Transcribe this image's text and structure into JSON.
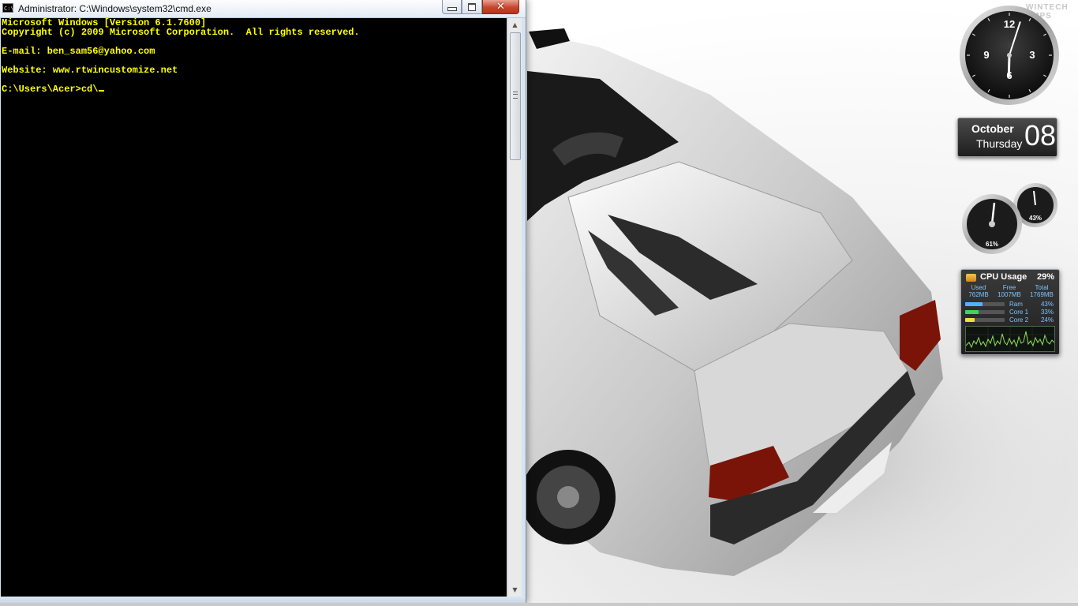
{
  "cmd_window": {
    "title": "Administrator: C:\\Windows\\system32\\cmd.exe",
    "icon": "cmd-icon",
    "icon_text": "C:\\",
    "controls": {
      "minimize": "minimize-icon",
      "maximize": "maximize-icon",
      "close_label": "✕"
    },
    "console_lines": [
      "Microsoft Windows [Version 6.1.7600]",
      "Copyright (c) 2009 Microsoft Corporation.  All rights reserved.",
      "",
      "E-mail: ben_sam56@yahoo.com",
      "",
      "Website: www.rtwincustomize.net",
      "",
      "C:\\Users\\Acer>cd\\"
    ],
    "text_color": "#ffff00",
    "background_color": "#000000"
  },
  "desktop": {
    "watermark_line1": "WINTECH",
    "watermark_line2": "AMPS"
  },
  "clock_gadget": {
    "numbers": {
      "n12": "12",
      "n3": "3",
      "n6": "6",
      "n9": "9"
    },
    "time": {
      "hour": 6,
      "minute": 3
    }
  },
  "calendar_gadget": {
    "month": "October",
    "weekday": "Thursday",
    "day": "08"
  },
  "meters_gadget": {
    "cpu_percent": "61%",
    "ram_percent": "43%"
  },
  "cpu_gadget": {
    "title": "CPU Usage",
    "total_percent": "29%",
    "memory": {
      "used_label": "Used",
      "used_value": "762MB",
      "free_label": "Free",
      "free_value": "1007MB",
      "total_label": "Total",
      "total_value": "1769MB"
    },
    "bars": [
      {
        "name": "Ram",
        "value": "43%",
        "fraction": 0.43,
        "color": "#4fb3ff"
      },
      {
        "name": "Core 1",
        "value": "33%",
        "fraction": 0.33,
        "color": "#3ed55a"
      },
      {
        "name": "Core 2",
        "value": "24%",
        "fraction": 0.24,
        "color": "#e8e23a"
      }
    ],
    "graph_color": "#8fe05a"
  }
}
